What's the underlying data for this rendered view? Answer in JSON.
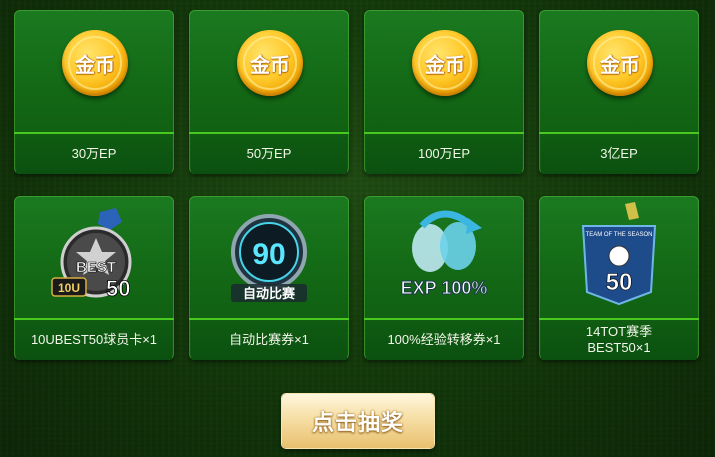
{
  "rewards": [
    {
      "label": "30万EP",
      "icon": "gold-coin-icon",
      "icon_text": "金币"
    },
    {
      "label": "50万EP",
      "icon": "gold-coin-icon",
      "icon_text": "金币"
    },
    {
      "label": "100万EP",
      "icon": "gold-coin-icon",
      "icon_text": "金币"
    },
    {
      "label": "3亿EP",
      "icon": "gold-coin-icon",
      "icon_text": "金币"
    },
    {
      "label": "10UBEST50球员卡×1",
      "icon": "best-player-card-icon",
      "icon_text": "BEST",
      "badge": "10U",
      "number": "50"
    },
    {
      "label": "自动比赛券×1",
      "icon": "auto-match-ticket-icon",
      "icon_text": "90",
      "caption": "自动比赛"
    },
    {
      "label": "100%经验转移券×1",
      "icon": "exp-transfer-ticket-icon",
      "icon_text": "EXP 100%"
    },
    {
      "label": "14TOT赛季BEST50×1",
      "label_line1": "14TOT赛季",
      "label_line2": "BEST50×1",
      "icon": "tot-season-card-icon",
      "icon_text": "TEAM OF THE SEASON",
      "number": "50"
    }
  ],
  "draw_button": {
    "label": "点击抽奖"
  },
  "colors": {
    "card_green": "#127016",
    "accent_green": "#49c820",
    "coin_gold": "#ffc92a",
    "button_gold": "#f3d591"
  }
}
